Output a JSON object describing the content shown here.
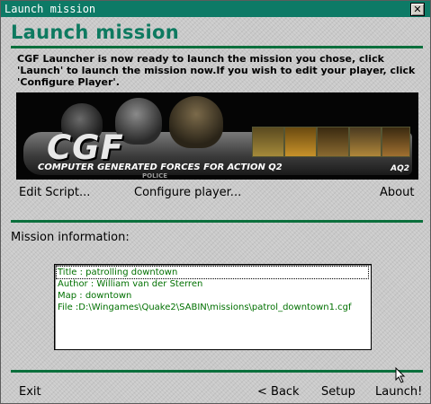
{
  "window": {
    "title": "Launch mission",
    "close_glyph": "✕"
  },
  "header": {
    "title": "Launch mission"
  },
  "description": "CGF Launcher is now ready to launch the mission you chose, click 'Launch' to launch the mission now.If you wish to edit your player, click 'Configure Player'.",
  "banner": {
    "logo": "CGF",
    "tagline": "COMPUTER GENERATED FORCES FOR ACTION Q2",
    "badge": "AQ2",
    "small_text": "POLICE"
  },
  "actions": {
    "edit_script": "Edit Script...",
    "configure_player": "Configure player...",
    "about": "About"
  },
  "mission_info": {
    "label": "Mission information:",
    "lines": [
      "Title : patrolling downtown",
      "Author : William van der Sterren",
      "Map : downtown",
      "File :D:\\Wingames\\Quake2\\SABIN\\missions\\patrol_downtown1.cgf"
    ]
  },
  "footer": {
    "exit": "Exit",
    "back": "< Back",
    "setup": "Setup",
    "launch": "Launch!"
  },
  "colors": {
    "titlebar": "#0d7a66",
    "heading": "#0e7a60",
    "rule": "#0b6f3c",
    "list_text": "#007000"
  }
}
